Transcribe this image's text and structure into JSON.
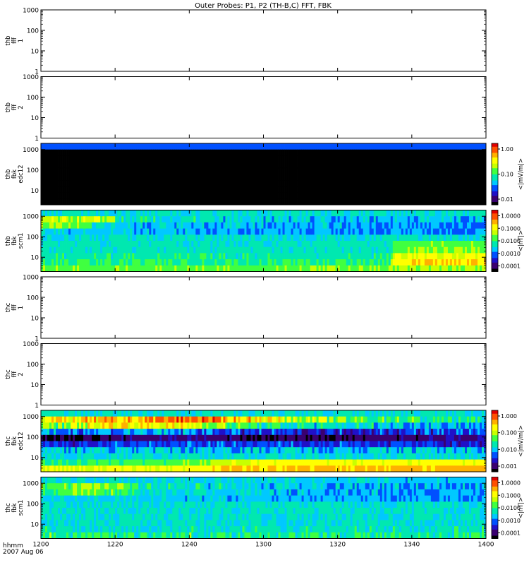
{
  "title": "Outer Probes: P1, P2 (TH-B,C) FFT, FBK",
  "time_axis": {
    "label_line1": "hhmm",
    "label_line2": "2007 Aug 06",
    "ticks": [
      "1200",
      "1220",
      "1240",
      "1300",
      "1320",
      "1340",
      "1400"
    ],
    "range_minutes": [
      0,
      120
    ]
  },
  "colors": {
    "colormap": [
      "#000000",
      "#3a0070",
      "#2010c8",
      "#0050ff",
      "#00c8ff",
      "#00e8b0",
      "#40ff40",
      "#c8ff00",
      "#ffff00",
      "#ffb000",
      "#ff5000",
      "#e00000"
    ]
  },
  "chart_data": [
    {
      "type": "heatmap",
      "ylabel": [
        "thb",
        "fff",
        "1"
      ],
      "yscale": "log",
      "ylim": [
        1,
        1000
      ],
      "yticks": [
        "1",
        "10",
        "100",
        "1000"
      ],
      "has_data": false,
      "colorbar": null
    },
    {
      "type": "heatmap",
      "ylabel": [
        "thb",
        "fff",
        "2"
      ],
      "yscale": "log",
      "ylim": [
        1,
        1000
      ],
      "yticks": [
        "1",
        "10",
        "100",
        "1000"
      ],
      "has_data": false,
      "colorbar": null
    },
    {
      "type": "heatmap",
      "ylabel": [
        "thb",
        "fbk",
        "edc12"
      ],
      "yscale": "log",
      "ylim": [
        2,
        2000
      ],
      "yticks": [
        "10",
        "100",
        "1000"
      ],
      "has_data": true,
      "bands": [
        {
          "profile": [
            [
              0,
              0.28
            ],
            [
              120,
              0.28
            ]
          ],
          "jitter": 0.03
        },
        {
          "profile": [
            [
              0,
              0.0
            ],
            [
              120,
              0.0
            ]
          ],
          "jitter": 0.0
        },
        {
          "profile": [
            [
              0,
              0.0
            ],
            [
              120,
              0.0
            ]
          ],
          "jitter": 0.0
        },
        {
          "profile": [
            [
              0,
              0.0
            ],
            [
              120,
              0.0
            ]
          ],
          "jitter": 0.0
        },
        {
          "profile": [
            [
              0,
              0.0
            ],
            [
              120,
              0.0
            ]
          ],
          "jitter": 0.0
        },
        {
          "profile": [
            [
              0,
              0.0
            ],
            [
              120,
              0.0
            ]
          ],
          "jitter": 0.0
        },
        {
          "profile": [
            [
              0,
              0.0
            ],
            [
              120,
              0.0
            ]
          ],
          "jitter": 0.0
        },
        {
          "profile": [
            [
              0,
              0.0
            ],
            [
              120,
              0.0
            ]
          ],
          "jitter": 0.0
        },
        {
          "profile": [
            [
              0,
              0.0
            ],
            [
              120,
              0.0
            ]
          ],
          "jitter": 0.0
        },
        {
          "profile": [
            [
              0,
              0.0
            ],
            [
              120,
              0.0
            ]
          ],
          "jitter": 0.0
        }
      ],
      "colorbar": {
        "label": "<|mV/m|>",
        "ticks": [
          "0.01",
          "0.10",
          "1.00"
        ]
      }
    },
    {
      "type": "heatmap",
      "ylabel": [
        "thb",
        "fbk",
        "scm1"
      ],
      "yscale": "log",
      "ylim": [
        2,
        2000
      ],
      "yticks": [
        "10",
        "100",
        "1000"
      ],
      "has_data": true,
      "bands": [
        {
          "profile": [
            [
              0,
              0.42
            ],
            [
              120,
              0.42
            ]
          ],
          "jitter": 0.03
        },
        {
          "profile": [
            [
              0,
              0.6
            ],
            [
              20,
              0.62
            ],
            [
              21,
              0.42
            ],
            [
              120,
              0.35
            ]
          ],
          "jitter": 0.1
        },
        {
          "profile": [
            [
              0,
              0.62
            ],
            [
              13,
              0.6
            ],
            [
              14,
              0.42
            ],
            [
              25,
              0.38
            ],
            [
              120,
              0.3
            ]
          ],
          "jitter": 0.08
        },
        {
          "profile": [
            [
              0,
              0.38
            ],
            [
              120,
              0.3
            ]
          ],
          "jitter": 0.06
        },
        {
          "profile": [
            [
              0,
              0.42
            ],
            [
              120,
              0.42
            ]
          ],
          "jitter": 0.05
        },
        {
          "profile": [
            [
              0,
              0.44
            ],
            [
              94,
              0.44
            ],
            [
              95,
              0.55
            ],
            [
              120,
              0.55
            ]
          ],
          "jitter": 0.05
        },
        {
          "profile": [
            [
              0,
              0.44
            ],
            [
              94,
              0.44
            ],
            [
              95,
              0.58
            ],
            [
              120,
              0.6
            ]
          ],
          "jitter": 0.06
        },
        {
          "profile": [
            [
              0,
              0.46
            ],
            [
              94,
              0.46
            ],
            [
              95,
              0.68
            ],
            [
              120,
              0.72
            ]
          ],
          "jitter": 0.06
        },
        {
          "profile": [
            [
              0,
              0.5
            ],
            [
              94,
              0.5
            ],
            [
              95,
              0.74
            ],
            [
              120,
              0.78
            ]
          ],
          "jitter": 0.06
        },
        {
          "profile": [
            [
              0,
              0.55
            ],
            [
              120,
              0.6
            ],
            [
              121,
              0.6
            ]
          ],
          "jitter": 0.05
        }
      ],
      "colorbar": {
        "label": "<|nT|>",
        "ticks": [
          "0.0001",
          "0.0010",
          "0.0100",
          "0.1000",
          "1.0000"
        ]
      }
    },
    {
      "type": "heatmap",
      "ylabel": [
        "thc",
        "fff",
        "1"
      ],
      "yscale": "log",
      "ylim": [
        1,
        1000
      ],
      "yticks": [
        "1",
        "10",
        "100",
        "1000"
      ],
      "has_data": false,
      "colorbar": null
    },
    {
      "type": "heatmap",
      "ylabel": [
        "thc",
        "fff",
        "2"
      ],
      "yscale": "log",
      "ylim": [
        1,
        1000
      ],
      "yticks": [
        "1",
        "10",
        "100",
        "1000"
      ],
      "has_data": false,
      "colorbar": null
    },
    {
      "type": "heatmap",
      "ylabel": [
        "thc",
        "fbk",
        "edc12"
      ],
      "yscale": "log",
      "ylim": [
        2,
        2000
      ],
      "yticks": [
        "10",
        "100",
        "1000"
      ],
      "has_data": true,
      "bands": [
        {
          "profile": [
            [
              0,
              0.42
            ],
            [
              120,
              0.42
            ]
          ],
          "jitter": 0.08
        },
        {
          "profile": [
            [
              0,
              0.72
            ],
            [
              20,
              0.78
            ],
            [
              40,
              0.9
            ],
            [
              55,
              0.78
            ],
            [
              80,
              0.55
            ],
            [
              120,
              0.45
            ]
          ],
          "jitter": 0.12
        },
        {
          "profile": [
            [
              0,
              0.55
            ],
            [
              20,
              0.75
            ],
            [
              40,
              0.7
            ],
            [
              60,
              0.45
            ],
            [
              120,
              0.35
            ]
          ],
          "jitter": 0.12
        },
        {
          "profile": [
            [
              0,
              0.3
            ],
            [
              30,
              0.35
            ],
            [
              60,
              0.2
            ],
            [
              120,
              0.25
            ]
          ],
          "jitter": 0.12
        },
        {
          "profile": [
            [
              0,
              0.02
            ],
            [
              20,
              0.08
            ],
            [
              40,
              0.12
            ],
            [
              60,
              0.05
            ],
            [
              120,
              0.12
            ]
          ],
          "jitter": 0.06
        },
        {
          "profile": [
            [
              0,
              0.2
            ],
            [
              40,
              0.25
            ],
            [
              120,
              0.2
            ]
          ],
          "jitter": 0.1
        },
        {
          "profile": [
            [
              0,
              0.38
            ],
            [
              120,
              0.38
            ]
          ],
          "jitter": 0.1
        },
        {
          "profile": [
            [
              0,
              0.4
            ],
            [
              120,
              0.42
            ]
          ],
          "jitter": 0.08
        },
        {
          "profile": [
            [
              0,
              0.5
            ],
            [
              40,
              0.55
            ],
            [
              60,
              0.72
            ],
            [
              120,
              0.72
            ]
          ],
          "jitter": 0.05
        },
        {
          "profile": [
            [
              0,
              0.68
            ],
            [
              40,
              0.7
            ],
            [
              50,
              0.78
            ],
            [
              120,
              0.8
            ]
          ],
          "jitter": 0.03
        }
      ],
      "colorbar": {
        "label": "<|mV/m|>",
        "ticks": [
          "0.001",
          "0.010",
          "0.100",
          "1.000"
        ]
      }
    },
    {
      "type": "heatmap",
      "ylabel": [
        "thc",
        "fbk",
        "scm1"
      ],
      "yscale": "log",
      "ylim": [
        2,
        2000
      ],
      "yticks": [
        "10",
        "100",
        "1000"
      ],
      "has_data": true,
      "bands": [
        {
          "profile": [
            [
              0,
              0.42
            ],
            [
              120,
              0.36
            ]
          ],
          "jitter": 0.06
        },
        {
          "profile": [
            [
              0,
              0.5
            ],
            [
              12,
              0.62
            ],
            [
              22,
              0.55
            ],
            [
              35,
              0.42
            ],
            [
              120,
              0.32
            ]
          ],
          "jitter": 0.1
        },
        {
          "profile": [
            [
              0,
              0.5
            ],
            [
              12,
              0.6
            ],
            [
              30,
              0.42
            ],
            [
              120,
              0.3
            ]
          ],
          "jitter": 0.08
        },
        {
          "profile": [
            [
              0,
              0.4
            ],
            [
              120,
              0.32
            ]
          ],
          "jitter": 0.06
        },
        {
          "profile": [
            [
              0,
              0.42
            ],
            [
              120,
              0.42
            ]
          ],
          "jitter": 0.04
        },
        {
          "profile": [
            [
              0,
              0.42
            ],
            [
              120,
              0.42
            ]
          ],
          "jitter": 0.05
        },
        {
          "profile": [
            [
              0,
              0.42
            ],
            [
              120,
              0.42
            ]
          ],
          "jitter": 0.05
        },
        {
          "profile": [
            [
              0,
              0.42
            ],
            [
              120,
              0.42
            ]
          ],
          "jitter": 0.05
        },
        {
          "profile": [
            [
              0,
              0.44
            ],
            [
              120,
              0.44
            ]
          ],
          "jitter": 0.07
        },
        {
          "profile": [
            [
              0,
              0.5
            ],
            [
              120,
              0.48
            ]
          ],
          "jitter": 0.1
        }
      ],
      "colorbar": {
        "label": "<|nT|>",
        "ticks": [
          "0.0001",
          "0.0010",
          "0.0100",
          "0.1000",
          "1.0000"
        ]
      }
    }
  ]
}
